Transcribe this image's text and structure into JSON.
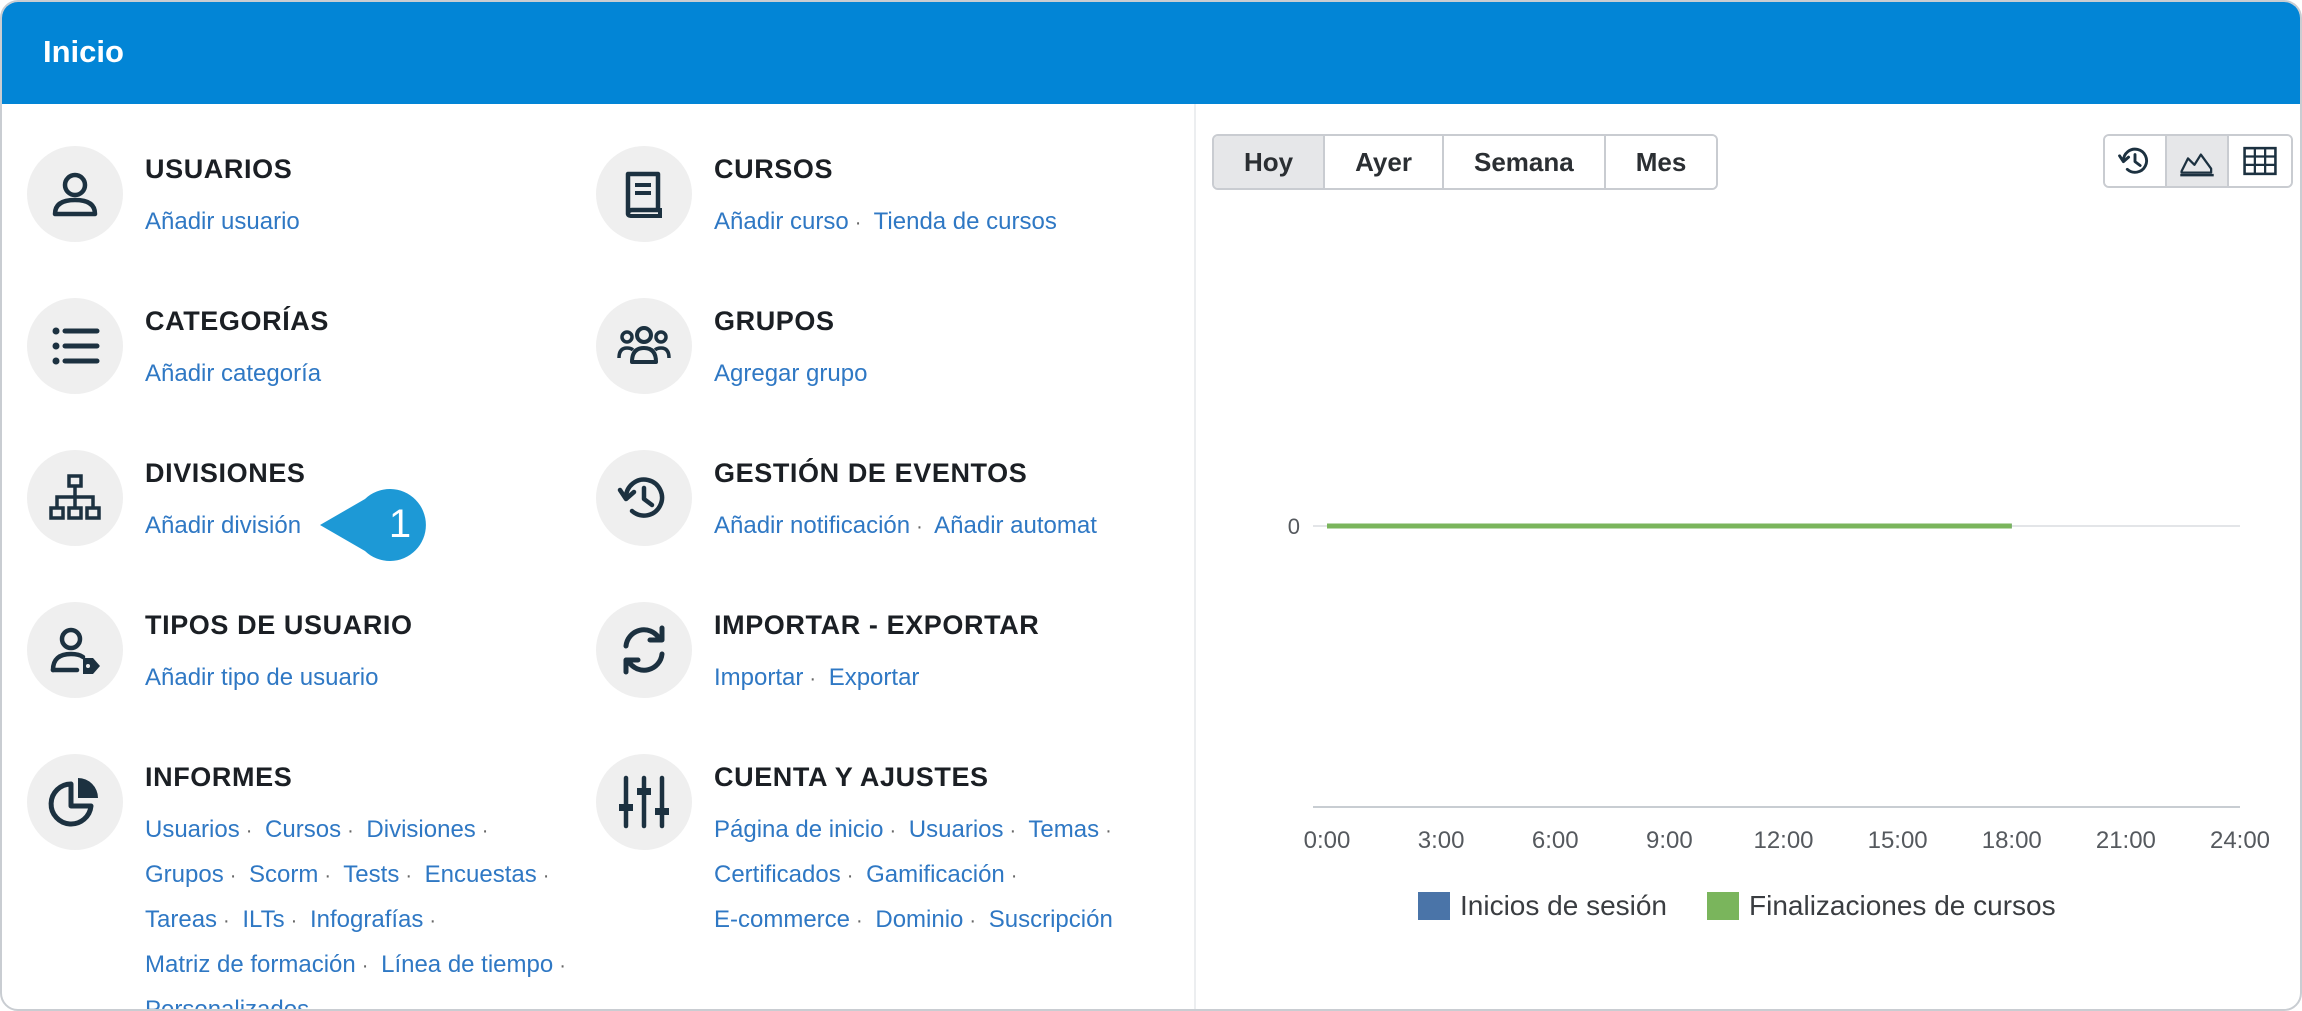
{
  "header": {
    "title": "Inicio"
  },
  "tiles": [
    {
      "title": "USUARIOS",
      "icon": "user-icon",
      "links": [
        "Añadir usuario"
      ]
    },
    {
      "title": "CURSOS",
      "icon": "book-icon",
      "links": [
        "Añadir curso",
        "Tienda de cursos"
      ]
    },
    {
      "title": "CATEGORÍAS",
      "icon": "list-icon",
      "links": [
        "Añadir categoría"
      ]
    },
    {
      "title": "GRUPOS",
      "icon": "group-icon",
      "links": [
        "Agregar grupo"
      ]
    },
    {
      "title": "DIVISIONES",
      "icon": "org-chart-icon",
      "links": [
        "Añadir división"
      ]
    },
    {
      "title": "GESTIÓN DE EVENTOS",
      "icon": "history-icon",
      "links": [
        "Añadir notificación",
        "Añadir automat"
      ]
    },
    {
      "title": "TIPOS DE USUARIO",
      "icon": "user-tag-icon",
      "links": [
        "Añadir tipo de usuario"
      ]
    },
    {
      "title": "IMPORTAR - EXPORTAR",
      "icon": "sync-icon",
      "links": [
        "Importar",
        "Exportar"
      ]
    },
    {
      "title": "INFORMES",
      "icon": "pie-chart-icon",
      "links": [
        "Usuarios",
        "Cursos",
        "Divisiones",
        "Grupos",
        "Scorm",
        "Tests",
        "Encuestas",
        "Tareas",
        "ILTs",
        "Infografías",
        "Matriz de formación",
        "Línea de tiempo",
        "Personalizados"
      ]
    },
    {
      "title": "CUENTA Y AJUSTES",
      "icon": "sliders-icon",
      "links": [
        "Página de inicio",
        "Usuarios",
        "Temas",
        "Certificados",
        "Gamificación",
        "E-commerce",
        "Dominio",
        "Suscripción"
      ]
    }
  ],
  "callout": {
    "number": "1"
  },
  "range_buttons": [
    {
      "label": "Hoy",
      "active": true
    },
    {
      "label": "Ayer",
      "active": false
    },
    {
      "label": "Semana",
      "active": false
    },
    {
      "label": "Mes",
      "active": false
    }
  ],
  "view_buttons": [
    {
      "icon": "history-icon",
      "active": false
    },
    {
      "icon": "area-chart-icon",
      "active": true
    },
    {
      "icon": "table-grid-icon",
      "active": false
    }
  ],
  "colors": {
    "header": "#0285d6",
    "link": "#2f78c4",
    "series_logins": "#4a74a8",
    "series_completions": "#7ab55c"
  },
  "chart_data": {
    "type": "line",
    "x": [
      "0:00",
      "3:00",
      "6:00",
      "9:00",
      "12:00",
      "15:00",
      "18:00",
      "21:00",
      "24:00"
    ],
    "y_ticks": [
      "0"
    ],
    "series": [
      {
        "name": "Inicios de sesión",
        "color": "#4a74a8",
        "points": [
          [
            0,
            0
          ],
          [
            18,
            0
          ]
        ]
      },
      {
        "name": "Finalizaciones de cursos",
        "color": "#7ab55c",
        "points": [
          [
            0,
            0
          ],
          [
            18,
            0
          ]
        ]
      }
    ],
    "xlim": [
      0,
      24
    ],
    "ylabel": "",
    "xlabel": "",
    "legend": "bottom"
  }
}
